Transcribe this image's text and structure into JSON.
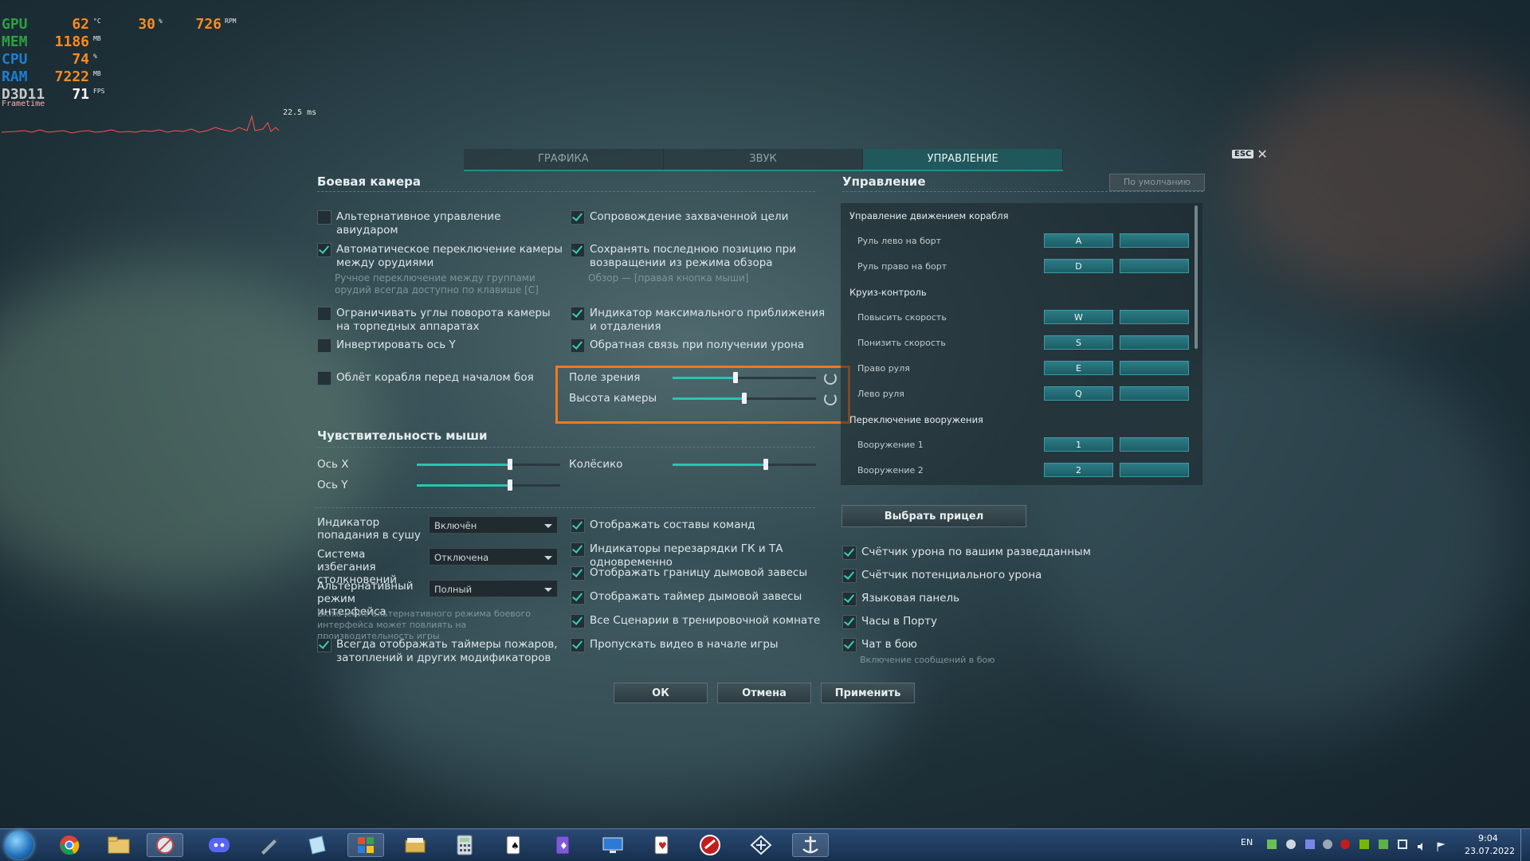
{
  "osd": {
    "gpu": {
      "label": "GPU",
      "temp": "62",
      "temp_unit": "°C",
      "load": "30",
      "load_unit": "%",
      "fan": "726",
      "fan_unit": "RPM"
    },
    "mem": {
      "label": "MEM",
      "value": "1186",
      "unit": "MB"
    },
    "cpu": {
      "label": "CPU",
      "value": "74",
      "unit": "%"
    },
    "ram": {
      "label": "RAM",
      "value": "7222",
      "unit": "MB"
    },
    "api": {
      "label": "D3D11",
      "value": "71",
      "unit": "FPS"
    },
    "frametime_label": "Frametime",
    "frametime_ms": "22.5 ms",
    "colors": {
      "gpu": "#2ea043",
      "mem": "#2ea043",
      "cpu": "#1e7fd0",
      "ram": "#1e7fd0",
      "api": "#c8c8c8",
      "value": "#ff8a1c"
    }
  },
  "tabs": [
    {
      "label": "ГРАФИКА",
      "active": false
    },
    {
      "label": "ЗВУК",
      "active": false
    },
    {
      "label": "УПРАВЛЕНИЕ",
      "active": true
    }
  ],
  "esc_label": "ESC",
  "combat_camera": {
    "title": "Боевая камера",
    "left": [
      {
        "label": "Альтернативное управление авиударом",
        "checked": false
      },
      {
        "label": "Автоматическое переключение камеры между орудиями",
        "checked": true,
        "hint": "Ручное переключение между группами орудий всегда доступно по клавише [C]"
      },
      {
        "label": "Ограничивать углы поворота камеры на торпедных аппаратах",
        "checked": false
      },
      {
        "label": "Инвертировать ось Y",
        "checked": false
      },
      {
        "label": "Облёт корабля перед началом боя",
        "checked": false
      }
    ],
    "right": [
      {
        "label": "Сопровождение захваченной цели",
        "checked": true
      },
      {
        "label": "Сохранять последнюю позицию при возвращении из режима обзора",
        "checked": true,
        "hint": "Обзор — [правая кнопка мыши]"
      },
      {
        "label": "Индикатор максимального приближения и отдаления",
        "checked": true
      },
      {
        "label": "Обратная связь при получении урона",
        "checked": true
      }
    ],
    "sliders": [
      {
        "label": "Поле зрения",
        "value": 0.44
      },
      {
        "label": "Высота камеры",
        "value": 0.5
      }
    ]
  },
  "mouse": {
    "title": "Чувствительность мыши",
    "sliders": [
      {
        "label": "Ось X",
        "value": 0.65
      },
      {
        "label": "Ось Y",
        "value": 0.65
      },
      {
        "label": "Колёсико",
        "value": 0.65
      }
    ]
  },
  "dropdowns": [
    {
      "label": "Индикатор попадания в сушу",
      "value": "Включён"
    },
    {
      "label": "Система избегания столкновений",
      "value": "Отключена"
    },
    {
      "label": "Альтернативный режим интерфейса",
      "value": "Полный"
    }
  ],
  "alt_ui_hint": "Включение альтернативного режима боевого интерфейса может повлиять на производительность игры",
  "timers_checkbox": {
    "label": "Всегда отображать таймеры пожаров, затоплений и других модификаторов",
    "checked": true
  },
  "middle_checks": [
    {
      "label": "Отображать составы команд",
      "checked": true
    },
    {
      "label": "Индикаторы перезарядки ГК и ТА одновременно",
      "checked": true
    },
    {
      "label": "Отображать границу дымовой завесы",
      "checked": true
    },
    {
      "label": "Отображать таймер дымовой завесы",
      "checked": true
    },
    {
      "label": "Все Сценарии в тренировочной комнате",
      "checked": true
    },
    {
      "label": "Пропускать видео в начале игры",
      "checked": true
    }
  ],
  "controls": {
    "title": "Управление",
    "default_button": "По умолчанию",
    "groups": [
      {
        "title": "Управление движением корабля",
        "items": [
          {
            "label": "Руль лево на борт",
            "key": "A",
            "alt": ""
          },
          {
            "label": "Руль право на борт",
            "key": "D",
            "alt": ""
          }
        ]
      },
      {
        "title": "Круиз-контроль",
        "items": [
          {
            "label": "Повысить скорость",
            "key": "W",
            "alt": ""
          },
          {
            "label": "Понизить скорость",
            "key": "S",
            "alt": ""
          },
          {
            "label": "Право руля",
            "key": "E",
            "alt": ""
          },
          {
            "label": "Лево руля",
            "key": "Q",
            "alt": ""
          }
        ]
      },
      {
        "title": "Переключение вооружения",
        "items": [
          {
            "label": "Вооружение 1",
            "key": "1",
            "alt": ""
          },
          {
            "label": "Вооружение 2",
            "key": "2",
            "alt": ""
          }
        ]
      }
    ],
    "choose_sight": "Выбрать прицел"
  },
  "right_checks": [
    {
      "label": "Счётчик урона по вашим разведданным",
      "checked": true
    },
    {
      "label": "Счётчик потенциального урона",
      "checked": true
    },
    {
      "label": "Языковая панель",
      "checked": true
    },
    {
      "label": "Часы в Порту",
      "checked": true
    },
    {
      "label": "Чат в бою",
      "checked": true
    }
  ],
  "chat_hint": "Включение сообщений в бою",
  "buttons": {
    "ok": "ОК",
    "cancel": "Отмена",
    "apply": "Применить"
  },
  "taskbar": {
    "apps": [
      "chrome",
      "explorer",
      "snipping-tool",
      "discord",
      "pen-tool",
      "notes",
      "paint",
      "folder",
      "calculator",
      "solitaire",
      "cards",
      "remote-desktop",
      "cards-2",
      "world-of-tanks",
      "wargaming",
      "world-of-warships"
    ],
    "lang": "EN",
    "time": "9:04",
    "date": "23.07.2022"
  }
}
